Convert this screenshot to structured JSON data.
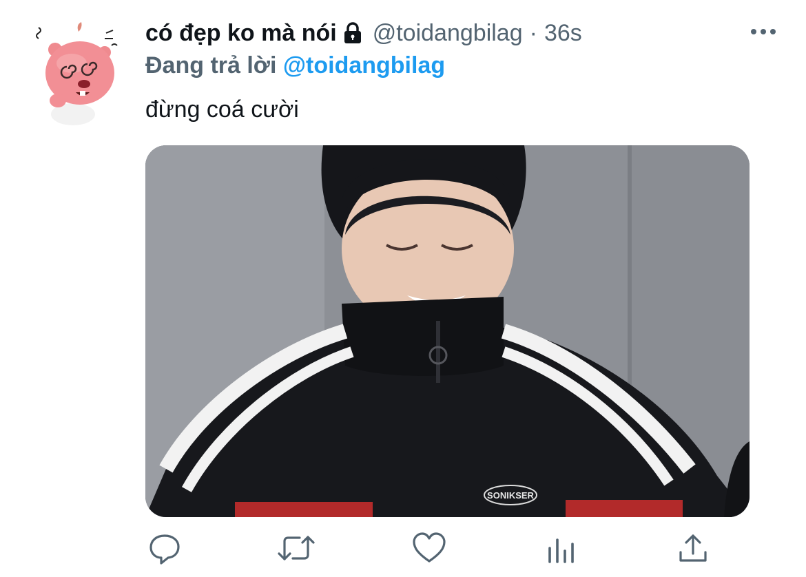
{
  "tweet": {
    "display_name": "có đẹp ko mà nói",
    "handle": "@toidangbilag",
    "separator": "·",
    "time": "36s",
    "reply_prefix": "Đang trả lời",
    "reply_to": "@toidangbilag",
    "text": "đừng coá cười",
    "media_caption_logo": "SONIKSER"
  },
  "icons": {
    "more": "more-horizontal-icon",
    "lock": "lock-icon",
    "reply": "reply-icon",
    "retweet": "retweet-icon",
    "like": "heart-icon",
    "analytics": "analytics-icon",
    "share": "share-icon"
  },
  "colors": {
    "text_primary": "#0f1419",
    "text_secondary": "#536471",
    "accent": "#1d9bf0"
  }
}
